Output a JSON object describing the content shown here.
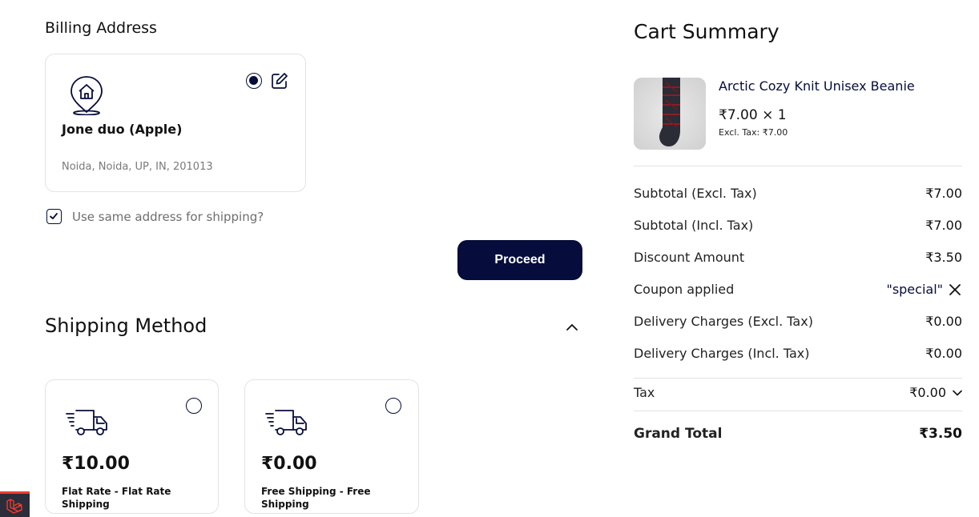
{
  "billing": {
    "title": "Billing Address",
    "address": {
      "name": "Jone duo (Apple)",
      "line": "Noida, Noida, UP, IN, 201013",
      "selected": true
    },
    "same_for_shipping": {
      "label": "Use same address for shipping?",
      "checked": true
    },
    "proceed_label": "Proceed"
  },
  "shipping": {
    "title": "Shipping Method",
    "methods": [
      {
        "price": "₹10.00",
        "name": "Flat Rate - Flat Rate Shipping",
        "selected": false
      },
      {
        "price": "₹0.00",
        "name": "Free Shipping - Free Shipping",
        "selected": false
      }
    ]
  },
  "summary": {
    "title": "Cart Summary",
    "item": {
      "name": "Arctic Cozy Knit Unisex Beanie",
      "price_qty": "₹7.00 × 1",
      "excl_tax": "Excl. Tax: ₹7.00"
    },
    "rows": {
      "subtotal_excl": {
        "label": "Subtotal (Excl. Tax)",
        "value": "₹7.00"
      },
      "subtotal_incl": {
        "label": "Subtotal (Incl. Tax)",
        "value": "₹7.00"
      },
      "discount": {
        "label": "Discount Amount",
        "value": "₹3.50"
      },
      "coupon": {
        "label": "Coupon applied",
        "value": "\"special\""
      },
      "delivery_excl": {
        "label": "Delivery Charges (Excl. Tax)",
        "value": "₹0.00"
      },
      "delivery_incl": {
        "label": "Delivery Charges (Incl. Tax)",
        "value": "₹0.00"
      },
      "tax": {
        "label": "Tax",
        "value": "₹0.00"
      },
      "grand_total": {
        "label": "Grand Total",
        "value": "₹3.50"
      }
    }
  },
  "colors": {
    "primary": "#060c3b",
    "border": "#e3e3e3",
    "muted_text": "#7a7a7a",
    "laravel_red": "#ef3b2d"
  },
  "icons": {
    "address": "home-location-icon",
    "edit": "edit-icon",
    "shipping": "delivery-truck-icon",
    "collapse": "chevron-up-icon",
    "remove_coupon": "close-icon",
    "tax_expand": "chevron-down-icon",
    "debug": "laravel-logo-icon"
  }
}
